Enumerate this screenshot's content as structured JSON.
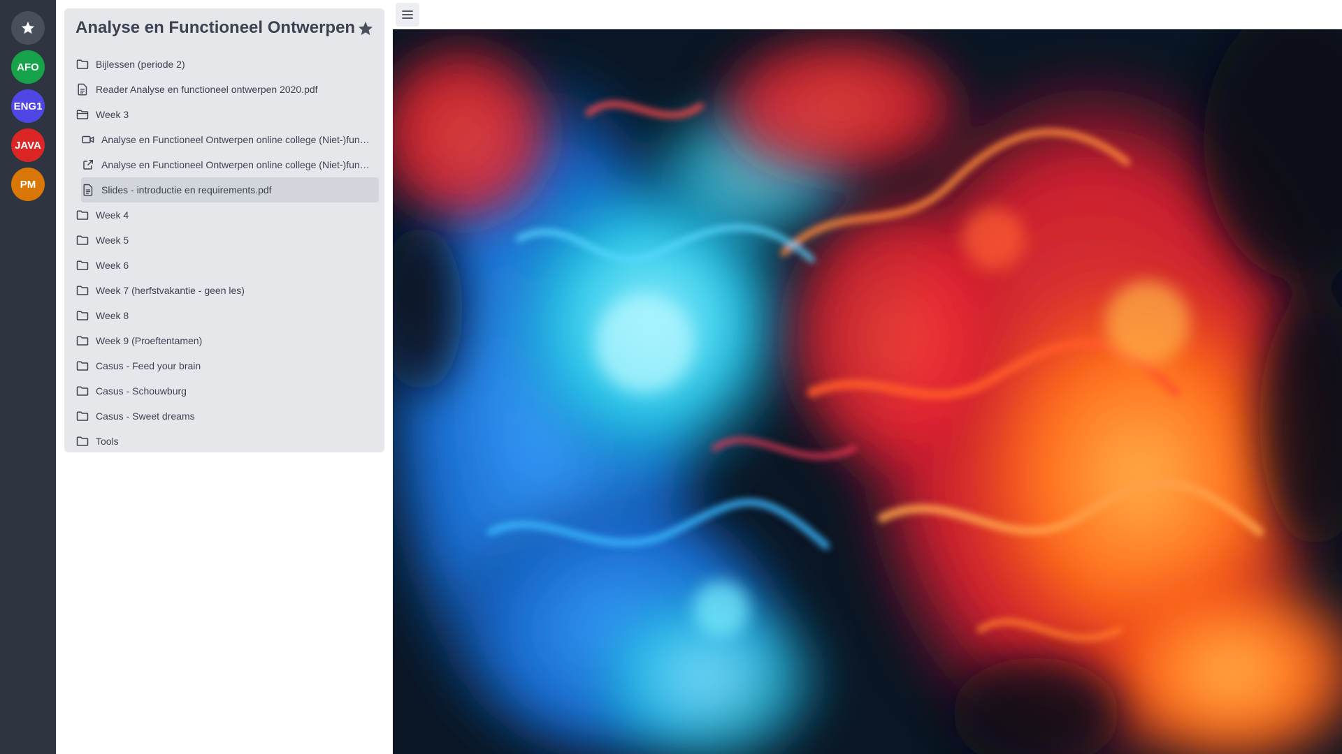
{
  "rail": {
    "items": [
      {
        "label": "",
        "icon": "star-icon",
        "color": "#4a505b"
      },
      {
        "label": "AFO",
        "color": "#16a34a"
      },
      {
        "label": "ENG1",
        "color": "#4f46e5"
      },
      {
        "label": "JAVA",
        "color": "#dc2626"
      },
      {
        "label": "PM",
        "color": "#d97706"
      }
    ]
  },
  "panel": {
    "title": "Analyse en Functioneel Ontwerpen",
    "items": [
      {
        "label": "Bijlessen (periode 2)",
        "icon": "folder-icon"
      },
      {
        "label": "Reader Analyse en functioneel ontwerpen 2020.pdf",
        "icon": "file-icon"
      },
      {
        "label": "Week 3",
        "icon": "folder-open-icon"
      },
      {
        "label": "Analyse en Functioneel Ontwerpen online college (Niet-)functionele eisen",
        "icon": "video-icon"
      },
      {
        "label": "Analyse en Functioneel Ontwerpen online college (Niet-)functionele eisen",
        "icon": "external-link-icon"
      },
      {
        "label": "Slides - introductie en requirements.pdf",
        "icon": "file-icon"
      },
      {
        "label": "Week 4",
        "icon": "folder-icon"
      },
      {
        "label": "Week 5",
        "icon": "folder-icon"
      },
      {
        "label": "Week 6",
        "icon": "folder-icon"
      },
      {
        "label": "Week 7 (herfstvakantie - geen les)",
        "icon": "folder-icon"
      },
      {
        "label": "Week 8",
        "icon": "folder-icon"
      },
      {
        "label": "Week 9 (Proeftentamen)",
        "icon": "folder-icon"
      },
      {
        "label": "Casus - Feed your brain",
        "icon": "folder-icon"
      },
      {
        "label": "Casus - Schouwburg",
        "icon": "folder-icon"
      },
      {
        "label": "Casus - Sweet dreams",
        "icon": "folder-icon"
      },
      {
        "label": "Tools",
        "icon": "folder-icon"
      }
    ]
  },
  "topbar": {
    "menu_icon": "hamburger-menu-icon"
  },
  "hero": {
    "image": "abstract colorful ink in water"
  }
}
